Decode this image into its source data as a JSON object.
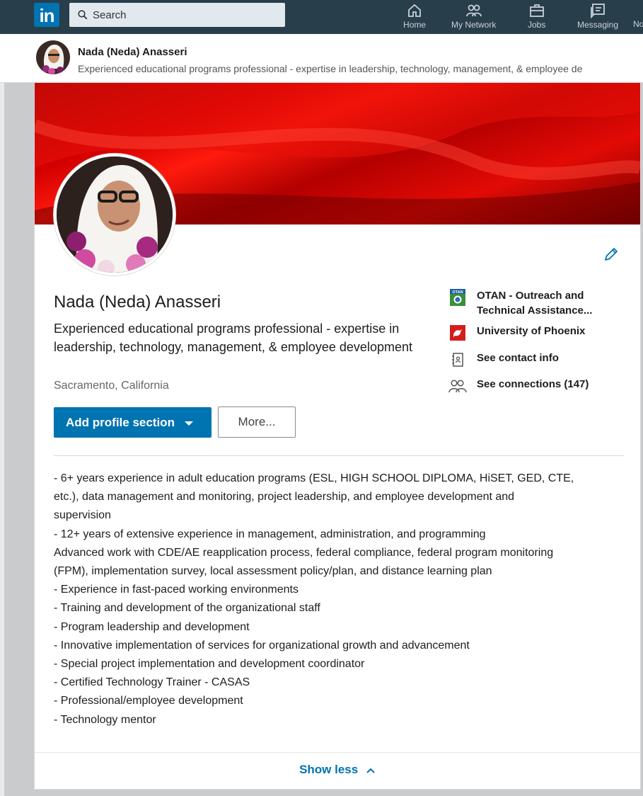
{
  "nav": {
    "logo_text": "in",
    "search_placeholder": "Search",
    "items": [
      {
        "label": "Home",
        "icon": "home-icon"
      },
      {
        "label": "My Network",
        "icon": "network-icon"
      },
      {
        "label": "Jobs",
        "icon": "jobs-icon"
      },
      {
        "label": "Messaging",
        "icon": "messaging-icon"
      },
      {
        "label": "No"
      }
    ]
  },
  "strip": {
    "name": "Nada (Neda) Anasseri",
    "headline": "Experienced educational programs professional - expertise in leadership, technology, management, & employee de"
  },
  "profile": {
    "name": "Nada (Neda) Anasseri",
    "headline": "Experienced educational programs professional - expertise in leadership, technology, management, & employee development",
    "location": "Sacramento, California",
    "edit_icon": "pencil-icon",
    "banner_color": "#cc0000"
  },
  "links": {
    "company": "OTAN - Outreach and Technical Assistance...",
    "company_logo_text": "OTAN",
    "school": "University of Phoenix",
    "contact": "See contact info",
    "connections": "See connections (147)"
  },
  "actions": {
    "add_section": "Add profile section",
    "more": "More..."
  },
  "summary_lines": [
    "- 6+ years experience in adult education programs (ESL, HIGH SCHOOL DIPLOMA, HiSET, GED, CTE,",
    "etc.), data management and monitoring, project leadership, and employee development and",
    "supervision",
    "- 12+ years of extensive experience in management, administration, and programming",
    "Advanced work with CDE/AE reapplication process, federal compliance, federal program monitoring",
    "(FPM), implementation survey, local assessment policy/plan, and distance learning plan",
    "- Experience in fast-paced working environments",
    "- Training and development of the organizational staff",
    "- Program leadership and development",
    "- Innovative implementation of services for organizational growth and advancement",
    "- Special project implementation and development coordinator",
    "- Certified Technology Trainer - CASAS",
    "- Professional/employee development",
    "- Technology mentor"
  ],
  "show_less": "Show less",
  "colors": {
    "nav_bg": "#283e4a",
    "accent": "#0073b1",
    "university_red": "#d1201c"
  }
}
